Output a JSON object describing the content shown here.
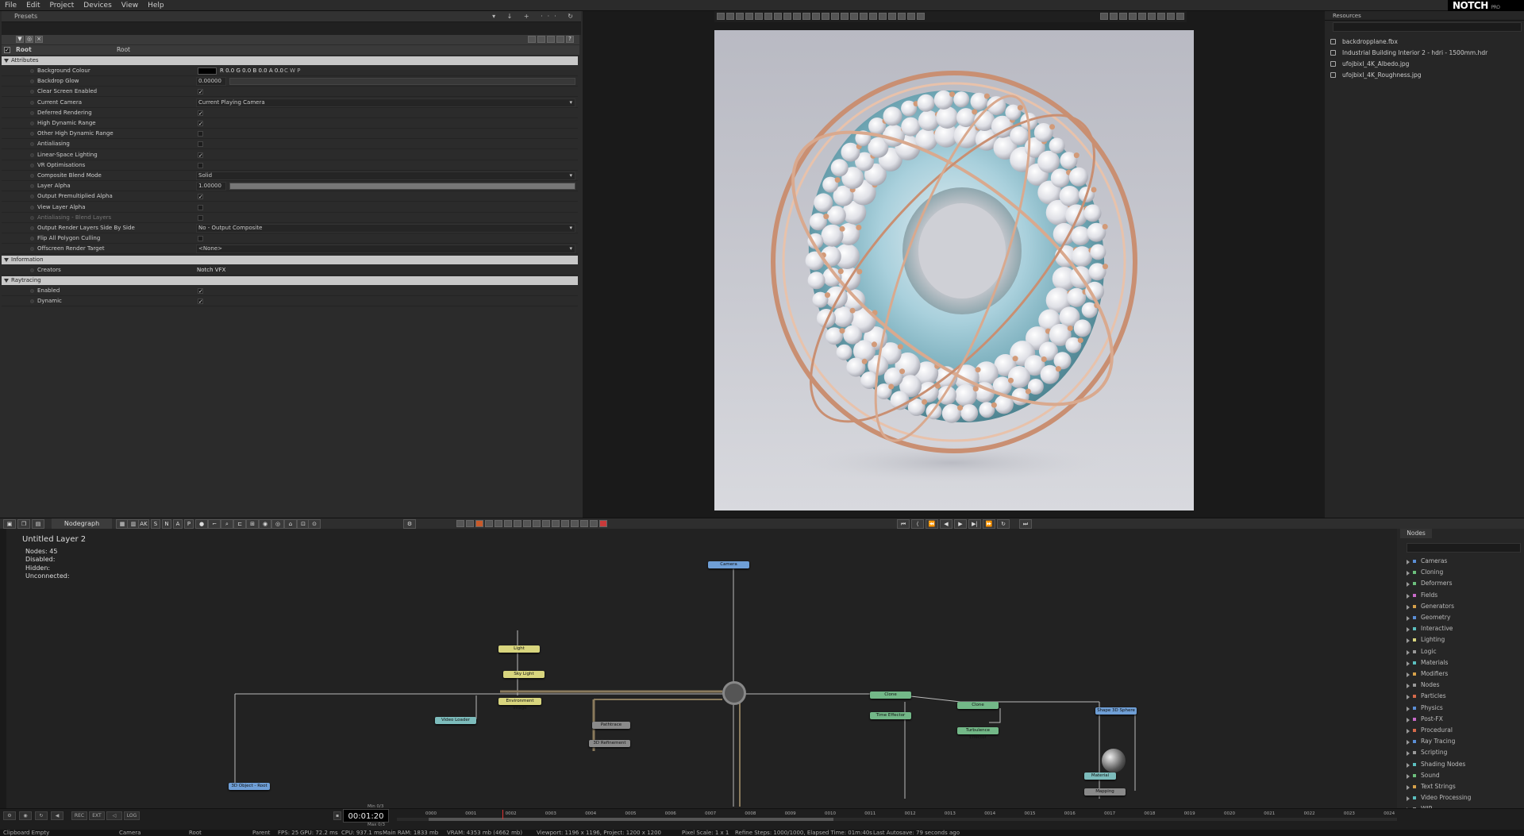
{
  "menu": [
    "File",
    "Edit",
    "Project",
    "Devices",
    "View",
    "Help"
  ],
  "logo": {
    "text": "NOTCH",
    "sub": "PRO"
  },
  "presets_title": "Presets",
  "root": {
    "label": "Root",
    "value": "Root"
  },
  "sections": {
    "attributes": "Attributes",
    "information": "Information",
    "raytracing": "Raytracing"
  },
  "attributes": [
    {
      "label": "Background Colour",
      "kind": "colour",
      "value": "R 0.0 G 0.0 B 0.0 A 0.0",
      "extra": "C   W   P"
    },
    {
      "label": "Backdrop Glow",
      "kind": "number",
      "value": "0.00000"
    },
    {
      "label": "Clear Screen Enabled",
      "kind": "check",
      "value": "✓"
    },
    {
      "label": "Current Camera",
      "kind": "dropdown",
      "value": "Current Playing Camera"
    },
    {
      "label": "Deferred Rendering",
      "kind": "check",
      "value": "✓"
    },
    {
      "label": "High Dynamic Range",
      "kind": "check",
      "value": "✓"
    },
    {
      "label": "Other High Dynamic Range",
      "kind": "check",
      "value": ""
    },
    {
      "label": "Antialiasing",
      "kind": "check",
      "value": ""
    },
    {
      "label": "Linear-Space Lighting",
      "kind": "check",
      "value": "✓"
    },
    {
      "label": "VR Optimisations",
      "kind": "check",
      "value": ""
    },
    {
      "label": "Composite Blend Mode",
      "kind": "dropdown",
      "value": "Solid"
    },
    {
      "label": "Layer Alpha",
      "kind": "slider",
      "value": "1.00000"
    },
    {
      "label": "Output Premultiplied Alpha",
      "kind": "check",
      "value": "✓"
    },
    {
      "label": "View Layer Alpha",
      "kind": "check",
      "value": ""
    },
    {
      "label": "Antialiasing - Blend Layers",
      "kind": "check",
      "value": "",
      "dim": true
    },
    {
      "label": "Output Render Layers Side By Side",
      "kind": "dropdown",
      "value": "No - Output Composite"
    },
    {
      "label": "Flip All Polygon Culling",
      "kind": "check",
      "value": ""
    },
    {
      "label": "Offscreen Render Target",
      "kind": "dropdown",
      "value": "<None>"
    }
  ],
  "information": [
    {
      "label": "Creators",
      "value": "Notch VFX"
    }
  ],
  "raytracing": [
    {
      "label": "Enabled",
      "value": "✓"
    },
    {
      "label": "Dynamic",
      "value": "✓"
    }
  ],
  "resources": {
    "title": "Resources",
    "items": [
      "backdropplane.fbx",
      "Industrial Building Interior 2 - hdri - 1500mm.hdr",
      "ufojbixl_4K_Albedo.jpg",
      "ufojbixl_4K_Roughness.jpg"
    ]
  },
  "nodegraph": {
    "tab": "Nodegraph",
    "layer_title": "Untitled  Layer  2",
    "stats": [
      "Nodes:  45",
      "Disabled:",
      "Hidden:",
      "Unconnected:"
    ],
    "toolbar_letters": [
      "AK",
      "S",
      "N",
      "A",
      "P"
    ],
    "nodes": [
      {
        "id": "camera",
        "label": "Camera",
        "color": "n-b"
      },
      {
        "id": "light",
        "label": "Light",
        "color": "n-y"
      },
      {
        "id": "sky-light",
        "label": "Sky Light",
        "color": "n-y"
      },
      {
        "id": "environment-image",
        "label": "Environment Image",
        "color": "n-y"
      },
      {
        "id": "video-loader",
        "label": "Video Loader",
        "color": "n-t"
      },
      {
        "id": "pathtrace",
        "label": "Pathtrace",
        "color": "n-gr"
      },
      {
        "id": "3d-refinement",
        "label": "3D Refinement",
        "color": "n-gr"
      },
      {
        "id": "clone-1",
        "label": "Clone",
        "color": "n-g"
      },
      {
        "id": "time-effector",
        "label": "Time Effector",
        "color": "n-g"
      },
      {
        "id": "clone-2",
        "label": "Clone",
        "color": "n-g"
      },
      {
        "id": "turbulence-effector",
        "label": "Turbulence Effector",
        "color": "n-g"
      },
      {
        "id": "shape-3d-sphere",
        "label": "Shape 3D Sphere",
        "color": "n-b"
      },
      {
        "id": "material",
        "label": "Material",
        "color": "n-t"
      },
      {
        "id": "mapping",
        "label": "Mapping",
        "color": "n-gr"
      },
      {
        "id": "3d-object-root",
        "label": "3D Object - Root",
        "color": "n-b"
      }
    ]
  },
  "palette": {
    "tab": "Nodes",
    "categories": [
      {
        "label": "Cameras",
        "color": "#5b8fd6"
      },
      {
        "label": "Cloning",
        "color": "#6cbf7c"
      },
      {
        "label": "Deformers",
        "color": "#6cbf7c"
      },
      {
        "label": "Fields",
        "color": "#c86ac8"
      },
      {
        "label": "Generators",
        "color": "#d6a14a"
      },
      {
        "label": "Geometry",
        "color": "#5b8fd6"
      },
      {
        "label": "Interactive",
        "color": "#5bbfbf"
      },
      {
        "label": "Lighting",
        "color": "#d8d57e"
      },
      {
        "label": "Logic",
        "color": "#999999"
      },
      {
        "label": "Materials",
        "color": "#5bbfbf"
      },
      {
        "label": "Modifiers",
        "color": "#d6a14a"
      },
      {
        "label": "Nodes",
        "color": "#999999"
      },
      {
        "label": "Particles",
        "color": "#d66a4a"
      },
      {
        "label": "Physics",
        "color": "#5b8fd6"
      },
      {
        "label": "Post-FX",
        "color": "#c86ac8"
      },
      {
        "label": "Procedural",
        "color": "#d66a4a"
      },
      {
        "label": "Ray Tracing",
        "color": "#5b8fd6"
      },
      {
        "label": "Scripting",
        "color": "#999999"
      },
      {
        "label": "Shading Nodes",
        "color": "#5bbfbf"
      },
      {
        "label": "Sound",
        "color": "#6cbf7c"
      },
      {
        "label": "Text Strings",
        "color": "#d6a14a"
      },
      {
        "label": "Video Processing",
        "color": "#5bbfbf"
      },
      {
        "label": "WIP",
        "color": "#999999"
      }
    ]
  },
  "timeline": {
    "timecode": "00:01:20",
    "min_label": "Min 0/3",
    "max_label": "Max 0/3",
    "buttons": [
      "REC",
      "EXT",
      "LOG"
    ],
    "ticks": [
      "0000",
      "0001",
      "0002",
      "0003",
      "0004",
      "0005",
      "0006",
      "0007",
      "0008",
      "0009",
      "0010",
      "0011",
      "0012",
      "0013",
      "0014",
      "0015",
      "0016",
      "0017",
      "0018",
      "0019",
      "0020",
      "0021",
      "0022",
      "0023",
      "0024"
    ]
  },
  "status": {
    "mode": "Clipboard Empty",
    "selection": "Camera",
    "layer": "Root",
    "parent": "Parent",
    "fps": "FPS: 25",
    "gpu": "GPU: 72.2 ms",
    "cpu": "CPU: 937.1 ms",
    "ram": "Main RAM: 1833 mb",
    "vram": "VRAM: 4353 mb (4662 mb)",
    "viewport": "Viewport: 1196 x 1196, Project: 1200 x 1200",
    "pixel": "Pixel Scale: 1 x 1",
    "refine": "Refine Steps: 1000/1000, Elapsed Time: 01m:40s",
    "autosave": "Last Autosave: 79 seconds ago"
  }
}
